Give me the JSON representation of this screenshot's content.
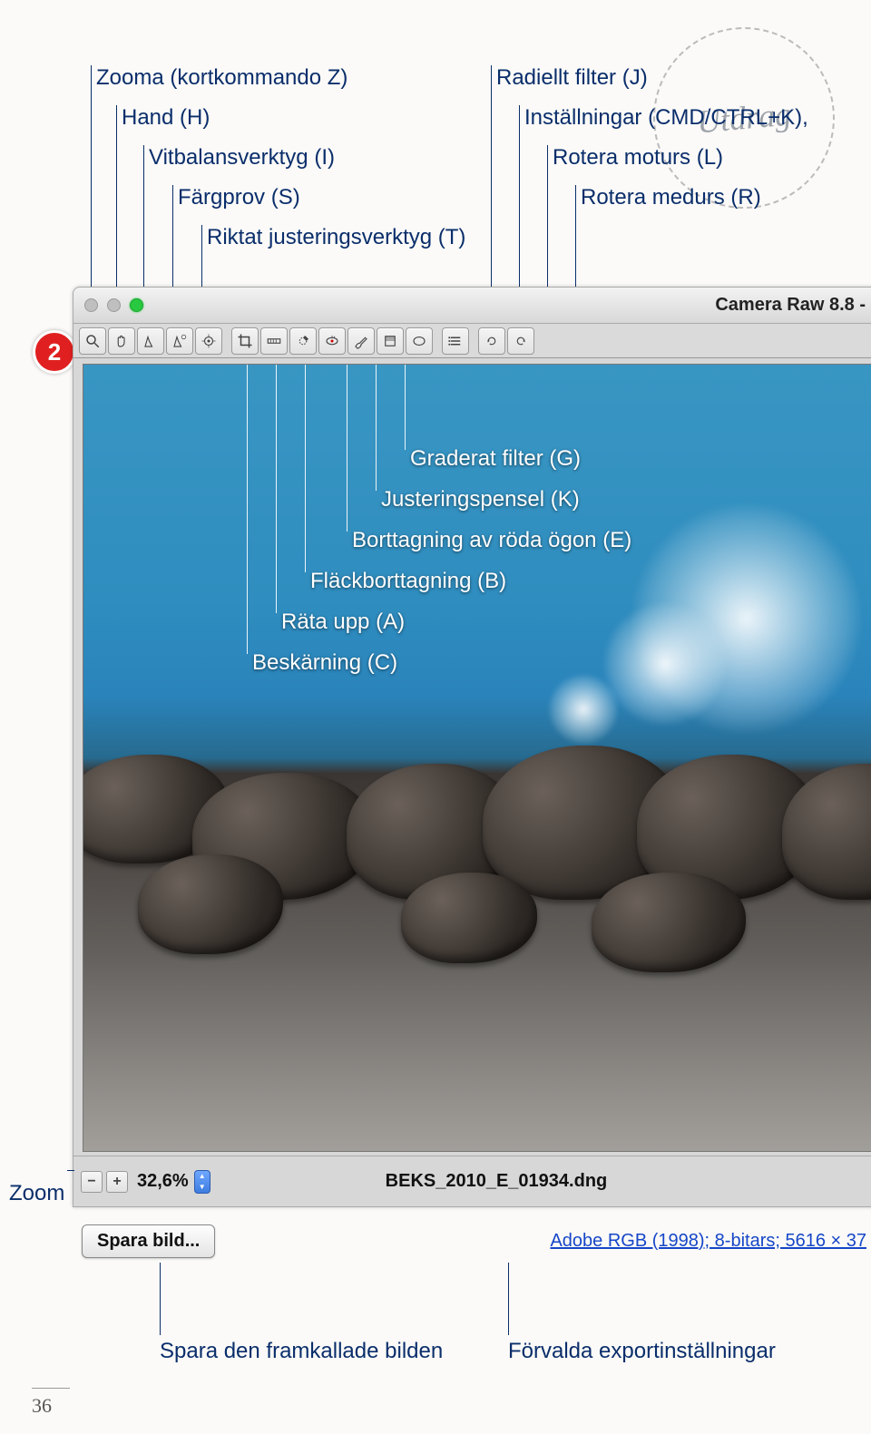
{
  "stamp": "Utdrag",
  "badge_number": "2",
  "top_callouts_left": {
    "zoom": "Zooma (kortkommando Z)",
    "hand": "Hand (H)",
    "whitebalance": "Vitbalansverktyg (I)",
    "colorsampler": "Färgprov (S)",
    "targetedadjust": "Riktat justeringsverktyg (T)"
  },
  "top_callouts_right": {
    "radialfilter": "Radiellt filter (J)",
    "settings": "Inställningar (CMD/CTRL+K),",
    "rotateccw": "Rotera moturs (L)",
    "rotatecw": "Rotera medurs (R)"
  },
  "window_title": "Camera Raw 8.8  -",
  "mid_callouts": {
    "graduated": "Graderat filter (G)",
    "brush": "Justeringspensel (K)",
    "redeye": "Borttagning av röda ögon (E)",
    "spot": "Fläckborttagning (B)",
    "straighten": "Räta upp (A)",
    "crop": "Beskärning (C)"
  },
  "toolbar_tools": [
    "zoom-tool",
    "hand-tool",
    "whitebalance-tool",
    "colorsampler-tool",
    "targetedadjust-tool",
    "crop-tool",
    "straighten-tool",
    "spot-tool",
    "redeye-tool",
    "brush-tool",
    "graduated-tool",
    "radial-tool",
    "settings-tool",
    "rotate-ccw-tool",
    "rotate-cw-tool"
  ],
  "status": {
    "zoom_value": "32,6%",
    "filename": "BEKS_2010_E_01934.dng"
  },
  "save_button": "Spara bild...",
  "export_link": "Adobe RGB (1998); 8-bitars; 5616 × 37",
  "left_label": "Zoom",
  "bottom_labels": {
    "save": "Spara den framkallade bilden",
    "preset": "Förvalda exportinställningar"
  },
  "page_number": "36"
}
